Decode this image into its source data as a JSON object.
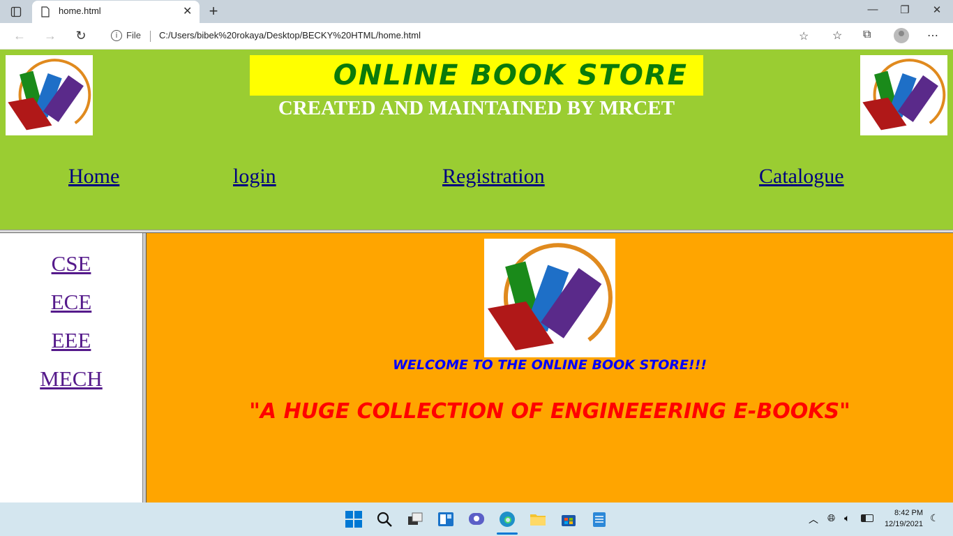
{
  "browser": {
    "tab_title": "home.html",
    "scheme_label": "File",
    "url": "C:/Users/bibek%20rokaya/Desktop/BECKY%20HTML/home.html"
  },
  "page": {
    "title": "ONLINE BOOK STORE",
    "subtitle": "CREATED AND MAINTAINED BY MRCET",
    "nav": [
      {
        "label": "Home"
      },
      {
        "label": "login"
      },
      {
        "label": "Registration"
      },
      {
        "label": "Catalogue"
      }
    ],
    "sidebar": [
      {
        "label": "CSE"
      },
      {
        "label": "ECE"
      },
      {
        "label": "EEE"
      },
      {
        "label": "MECH"
      }
    ],
    "welcome": "WELCOME TO THE ONLINE BOOK STORE!!!",
    "tagline": "\"A HUGE COLLECTION OF ENGINEEERING E-BOOKS\""
  },
  "taskbar": {
    "time": "8:42 PM",
    "date": "12/19/2021"
  },
  "colors": {
    "header_bg": "#9acd32",
    "title_bg": "#ffff00",
    "main_bg": "#ffa500",
    "welcome_color": "#0000ff",
    "tagline_color": "#ff0000"
  }
}
